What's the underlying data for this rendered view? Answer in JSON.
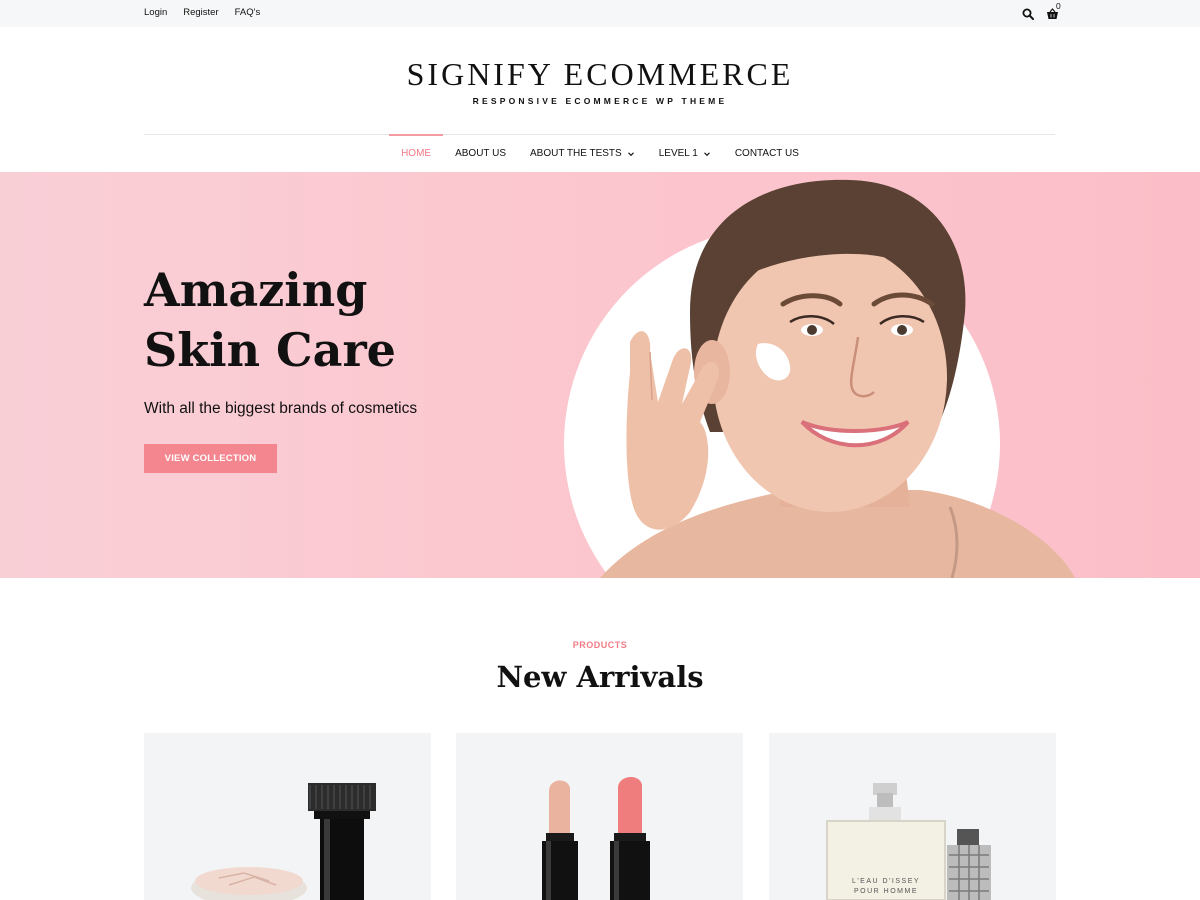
{
  "topbar": {
    "links": [
      "Login",
      "Register",
      "FAQ's"
    ],
    "cart_count": "0"
  },
  "header": {
    "title": "SIGNIFY ECOMMERCE",
    "tagline": "RESPONSIVE ECOMMERCE WP THEME"
  },
  "nav": {
    "items": [
      {
        "label": "HOME",
        "active": true
      },
      {
        "label": "ABOUT US"
      },
      {
        "label": "ABOUT THE TESTS",
        "has_dropdown": true
      },
      {
        "label": "LEVEL 1",
        "has_dropdown": true
      },
      {
        "label": "CONTACT US"
      }
    ]
  },
  "hero": {
    "title_line1": "Amazing",
    "title_line2": "Skin Care",
    "subtitle": "With all the biggest brands of cosmetics",
    "button": "VIEW COLLECTION"
  },
  "products": {
    "tag": "PRODUCTS",
    "title": "New Arrivals",
    "perfume_label_1": "L'EAU D'ISSEY",
    "perfume_label_2": "POUR HOMME"
  },
  "colors": {
    "accent": "#f27b86",
    "button": "#f48690",
    "hero_bg": "#fcc7cf",
    "topbar_bg": "#f6f7f8",
    "card_bg": "#f3f4f5"
  }
}
